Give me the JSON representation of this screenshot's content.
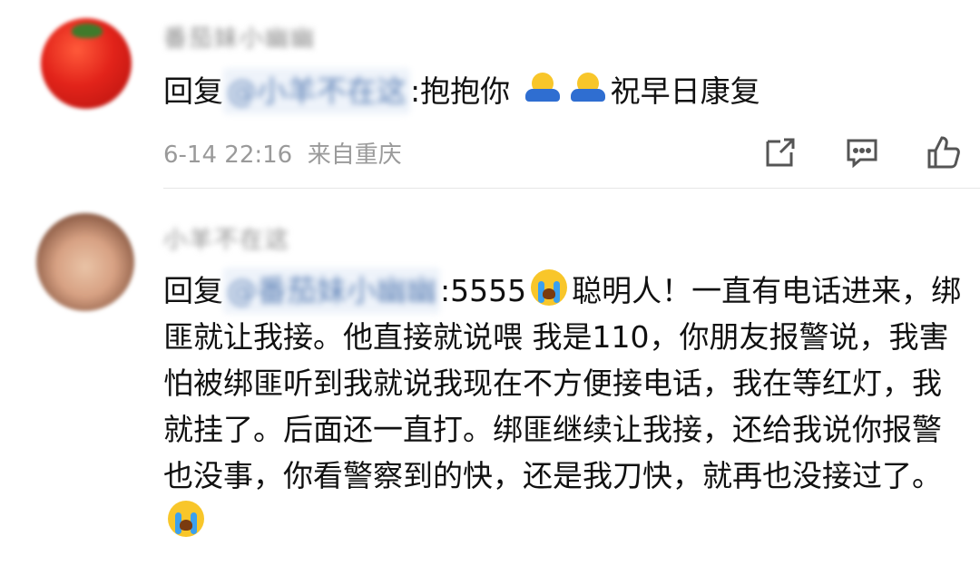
{
  "comments": [
    {
      "username": "番茄妹小幽幽",
      "reply_prefix": "回复",
      "mention": "@小羊不在这",
      "separator": ":",
      "text_before_emoji": "抱抱你",
      "text_after_emoji": "祝早日康复",
      "emoji": "hug-emoji",
      "timestamp": "6-14 22:16",
      "location": "来自重庆",
      "actions": [
        "share-icon",
        "comment-icon",
        "like-icon"
      ]
    },
    {
      "username": "小羊不在这",
      "reply_prefix": "回复",
      "mention": "@番茄妹小幽幽",
      "separator": ":",
      "text_start": "5555",
      "text_middle": "聪明人！一直有电话进来，绑匪就让我接。他直接就说喂 我是110，你朋友报警说，我害怕被绑匪听到我就说我现在不方便接电话，我在等红灯，我就挂了。后面还一直打。绑匪继续让我接，还给我说你报警也没事，你看警察到的快，还是我刀快，就再也没接过了。",
      "emoji": "crying-emoji"
    }
  ]
}
